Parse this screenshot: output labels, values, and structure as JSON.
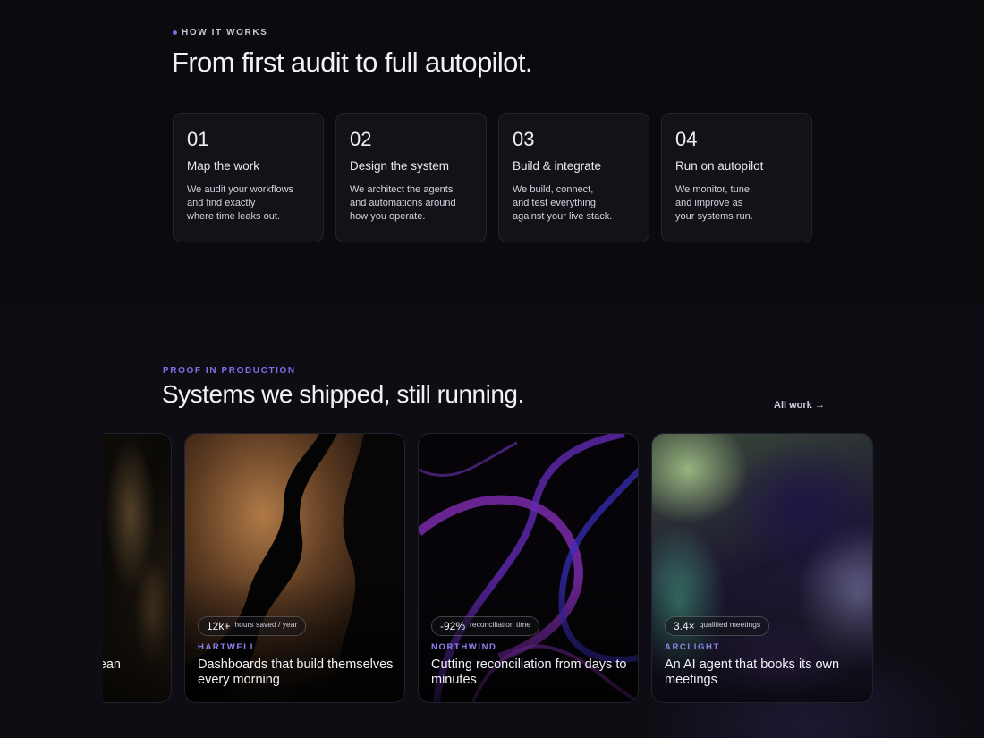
{
  "how_it_works": {
    "eyebrow": "HOW IT WORKS",
    "title": "From first audit to full autopilot.",
    "steps": [
      {
        "num": "01",
        "title": "Map the work",
        "desc": "We audit your workflows\nand find exactly\nwhere time leaks out."
      },
      {
        "num": "02",
        "title": "Design the system",
        "desc": "We architect the agents\nand automations around\nhow you operate."
      },
      {
        "num": "03",
        "title": "Build & integrate",
        "desc": "We build, connect,\nand test everything\nagainst your live stack."
      },
      {
        "num": "04",
        "title": "Run on autopilot",
        "desc": "We monitor, tune,\nand improve as\nyour systems run."
      }
    ]
  },
  "proof": {
    "eyebrow": "PROOF IN PRODUCTION",
    "title": "Systems we shipped, still running.",
    "all_work": "All work →",
    "accent": "#7f72ea",
    "partial_card": {
      "headline": "ean"
    },
    "cards": [
      {
        "stat": "12k+",
        "stat_label": "hours saved / year",
        "client": "HARTWELL",
        "headline": "Dashboards that build themselves every morning"
      },
      {
        "stat": "-92%",
        "stat_label": "reconciliation time",
        "client": "NORTHWIND",
        "headline": "Cutting reconciliation from days to minutes"
      },
      {
        "stat": "3.4×",
        "stat_label": "qualified meetings",
        "client": "ARCLIGHT",
        "headline": "An AI agent that books its own meetings"
      }
    ]
  }
}
